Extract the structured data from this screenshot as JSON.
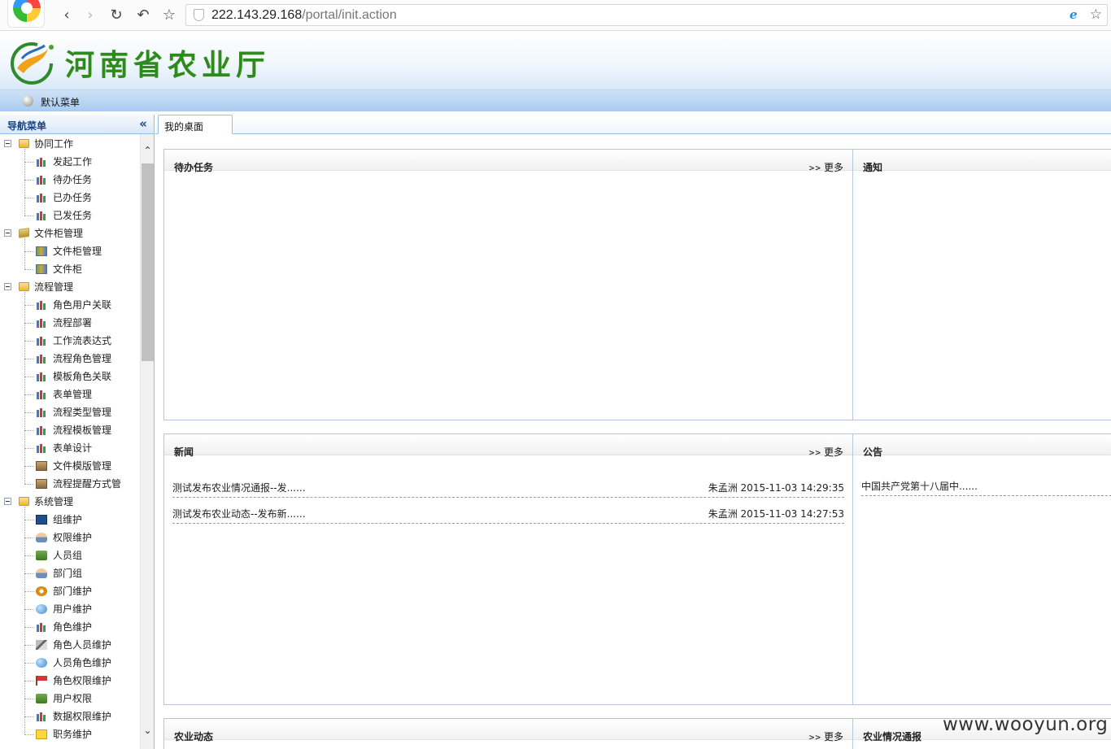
{
  "browser": {
    "url_host": "222.143.29.168",
    "url_path": "/portal/init.action",
    "back_glyph": "‹",
    "forward_glyph": "›",
    "reload_glyph": "↻",
    "undo_glyph": "↶",
    "star_glyph": "☆"
  },
  "header": {
    "site_title": "河南省农业厅",
    "menu_label": "默认菜单"
  },
  "sidebar": {
    "title": "导航菜单",
    "collapse_glyph": "«",
    "groups": [
      {
        "label": "协同工作",
        "icon": "folder-icon",
        "items": [
          {
            "label": "发起工作",
            "icon": "books-icon"
          },
          {
            "label": "待办任务",
            "icon": "books-icon"
          },
          {
            "label": "已办任务",
            "icon": "books-icon"
          },
          {
            "label": "已发任务",
            "icon": "books-icon"
          }
        ]
      },
      {
        "label": "文件柜管理",
        "icon": "cabinet-folder-icon",
        "items": [
          {
            "label": "文件柜管理",
            "icon": "cabinet-icon"
          },
          {
            "label": "文件柜",
            "icon": "cabinet-icon"
          }
        ]
      },
      {
        "label": "流程管理",
        "icon": "folder-icon",
        "items": [
          {
            "label": "角色用户关联",
            "icon": "books-icon"
          },
          {
            "label": "流程部署",
            "icon": "books-icon"
          },
          {
            "label": "工作流表达式",
            "icon": "books-icon"
          },
          {
            "label": "流程角色管理",
            "icon": "books-icon"
          },
          {
            "label": "模板角色关联",
            "icon": "books-icon"
          },
          {
            "label": "表单管理",
            "icon": "books-icon"
          },
          {
            "label": "流程类型管理",
            "icon": "books-icon"
          },
          {
            "label": "流程模板管理",
            "icon": "books-icon"
          },
          {
            "label": "表单设计",
            "icon": "books-icon"
          },
          {
            "label": "文件模版管理",
            "icon": "box-icon"
          },
          {
            "label": "流程提醒方式管",
            "icon": "box-icon"
          }
        ]
      },
      {
        "label": "系统管理",
        "icon": "folder-icon",
        "items": [
          {
            "label": "组维护",
            "icon": "book-dark-icon"
          },
          {
            "label": "权限维护",
            "icon": "person-icon"
          },
          {
            "label": "人员组",
            "icon": "group-icon"
          },
          {
            "label": "部门组",
            "icon": "person-icon"
          },
          {
            "label": "部门维护",
            "icon": "gear-icon"
          },
          {
            "label": "用户维护",
            "icon": "globe-icon"
          },
          {
            "label": "角色维护",
            "icon": "books-icon"
          },
          {
            "label": "角色人员维护",
            "icon": "tool-icon"
          },
          {
            "label": "人员角色维护",
            "icon": "globe-icon"
          },
          {
            "label": "角色权限维护",
            "icon": "flag-icon"
          },
          {
            "label": "用户权限",
            "icon": "group-icon"
          },
          {
            "label": "数据权限维护",
            "icon": "books-icon"
          },
          {
            "label": "职务维护",
            "icon": "note-icon"
          }
        ]
      }
    ]
  },
  "main": {
    "tab_label": "我的桌面",
    "more_arrows": ">>",
    "more_label": "更多",
    "panels": {
      "todo": {
        "title": "待办任务"
      },
      "notice": {
        "title": "通知"
      },
      "news": {
        "title": "新闻",
        "rows": [
          {
            "title": "测试发布农业情况通报--发......",
            "author": "朱孟洲",
            "time": "2015-11-03 14:29:35"
          },
          {
            "title": "测试发布农业动态--发布新......",
            "author": "朱孟洲",
            "time": "2015-11-03 14:27:53"
          }
        ]
      },
      "announcement": {
        "title": "公告",
        "rows": [
          {
            "title": "中国共产党第十八届中......"
          }
        ]
      },
      "agri_news": {
        "title": "农业动态"
      },
      "agri_report": {
        "title": "农业情况通报"
      }
    }
  },
  "watermark": "www.wooyun.org"
}
